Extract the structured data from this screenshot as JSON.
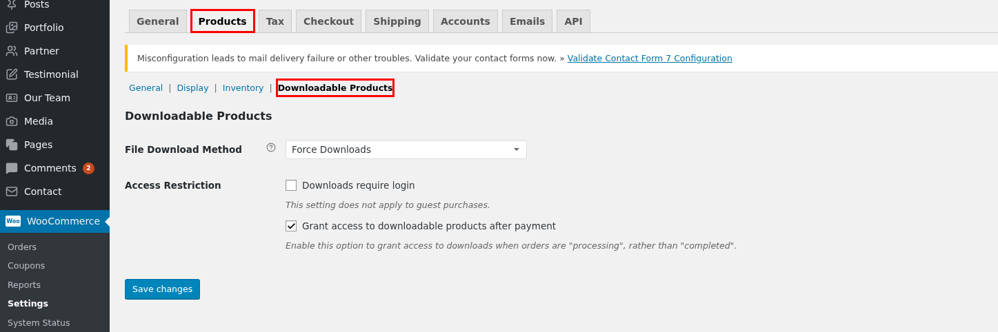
{
  "sidebar": {
    "items": [
      {
        "label": "Posts"
      },
      {
        "label": "Portfolio"
      },
      {
        "label": "Partner"
      },
      {
        "label": "Testimonial"
      },
      {
        "label": "Our Team"
      },
      {
        "label": "Media"
      },
      {
        "label": "Pages"
      },
      {
        "label": "Comments",
        "badge": "2"
      },
      {
        "label": "Contact"
      }
    ],
    "current": {
      "label": "WooCommerce",
      "logo": "Woo"
    },
    "submenu": [
      {
        "label": "Orders",
        "selected": false
      },
      {
        "label": "Coupons",
        "selected": false
      },
      {
        "label": "Reports",
        "selected": false
      },
      {
        "label": "Settings",
        "selected": true
      },
      {
        "label": "System Status",
        "selected": false
      }
    ]
  },
  "tabs": [
    {
      "label": "General",
      "selected": false,
      "highlighted": false
    },
    {
      "label": "Products",
      "selected": true,
      "highlighted": true
    },
    {
      "label": "Tax",
      "selected": false,
      "highlighted": false
    },
    {
      "label": "Checkout",
      "selected": false,
      "highlighted": false
    },
    {
      "label": "Shipping",
      "selected": false,
      "highlighted": false
    },
    {
      "label": "Accounts",
      "selected": false,
      "highlighted": false
    },
    {
      "label": "Emails",
      "selected": false,
      "highlighted": false
    },
    {
      "label": "API",
      "selected": false,
      "highlighted": false
    }
  ],
  "notice": {
    "text": "Misconfiguration leads to mail delivery failure or other troubles. Validate your contact forms now. »",
    "link": "Validate Contact Form 7 Configuration"
  },
  "subnav": [
    {
      "label": "General",
      "selected": false,
      "highlighted": false
    },
    {
      "label": "Display",
      "selected": false,
      "highlighted": false
    },
    {
      "label": "Inventory",
      "selected": false,
      "highlighted": false
    },
    {
      "label": "Downloadable Products",
      "selected": true,
      "highlighted": true
    }
  ],
  "separator": "|",
  "heading": "Downloadable Products",
  "fields": [
    {
      "kind": "select",
      "label": "File Download Method",
      "help": true,
      "value": "Force Downloads"
    },
    {
      "kind": "checkboxes",
      "label": "Access Restriction",
      "options": [
        {
          "label": "Downloads require login",
          "checked": false,
          "description": "This setting does not apply to guest purchases."
        },
        {
          "label": "Grant access to downloadable products after payment",
          "checked": true,
          "description": "Enable this option to grant access to downloads when orders are \"processing\", rather than \"completed\"."
        }
      ]
    }
  ],
  "save_button": "Save changes"
}
